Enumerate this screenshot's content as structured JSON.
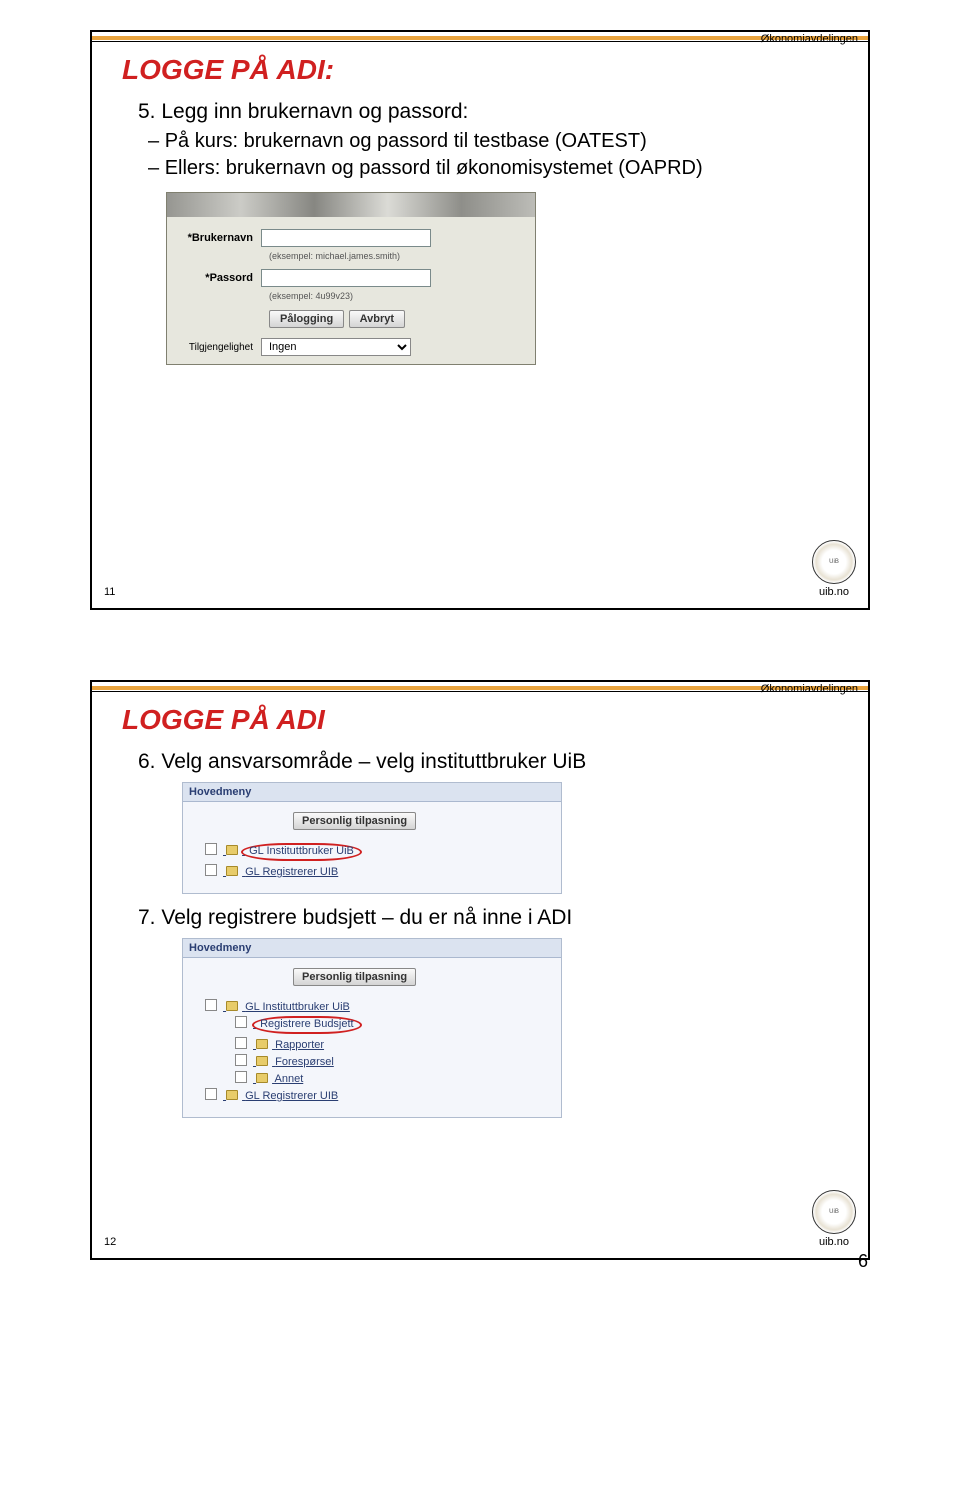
{
  "department": "Økonomiavdelingen",
  "logo_text": "uib.no",
  "slide1": {
    "number": "11",
    "title": "LOGGE PÅ ADI:",
    "bullet_main": "5.  Legg inn brukernavn og passord:",
    "sub1": "På kurs: brukernavn og passord til testbase (OATEST)",
    "sub2": "Ellers: brukernavn og passord til økonomisystemet (OAPRD)",
    "login": {
      "user_label": "*Brukernavn",
      "pass_label": "*Passord",
      "user_hint": "(eksempel: michael.james.smith)",
      "pass_hint": "(eksempel: 4u99v23)",
      "btn_login": "Pålogging",
      "btn_cancel": "Avbryt",
      "avail_label": "Tilgjengelighet",
      "avail_value": "Ingen"
    }
  },
  "slide2": {
    "number": "12",
    "title": "LOGGE PÅ ADI",
    "step6": "6. Velg ansvarsområde – velg instituttbruker UiB",
    "step7": "7. Velg registrere budsjett – du er nå inne i ADI",
    "menu": {
      "header": "Hovedmeny",
      "personalize": "Personlig tilpasning",
      "item_institutt": "GL Instituttbruker UiB",
      "item_registrerer": "GL Registrerer UIB",
      "sub_registrere": "Registrere Budsjett",
      "sub_rapporter": "Rapporter",
      "sub_foresporsel": "Forespørsel",
      "sub_annet": "Annet"
    }
  },
  "page_number": "6"
}
